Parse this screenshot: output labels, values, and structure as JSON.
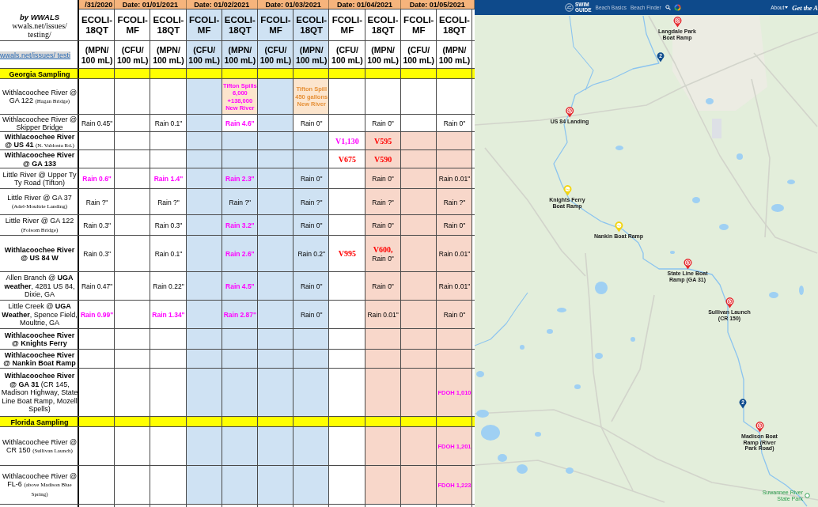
{
  "sheet": {
    "credit": "by WWALS",
    "site_url": "wwals.net/issues/ testing/",
    "link": "wwals.net/issues/ testi",
    "dates": [
      {
        "label": "/31/2020",
        "kind": "single"
      },
      {
        "label": "Date: 01/01/2021",
        "kind": "pair"
      },
      {
        "label": "Date: 01/02/2021",
        "kind": "pair"
      },
      {
        "label": "Date: 01/03/2021",
        "kind": "pair"
      },
      {
        "label": "Date: 01/04/2021",
        "kind": "pair"
      },
      {
        "label": "Date: 01/05/2021",
        "kind": "pair"
      }
    ],
    "columns": [
      {
        "test": "ECOLI-18QT",
        "unit": "(MPN/ 100 mL)",
        "highlighted": false
      },
      {
        "test": "FCOLI-MF",
        "unit": "(CFU/ 100 mL)",
        "highlighted": false
      },
      {
        "test": "ECOLI-18QT",
        "unit": "(MPN/ 100 mL)",
        "highlighted": false
      },
      {
        "test": "FCOLI-MF",
        "unit": "(CFU/ 100 mL)",
        "highlighted": true
      },
      {
        "test": "ECOLI-18QT",
        "unit": "(MPN/ 100 mL)",
        "highlighted": true
      },
      {
        "test": "FCOLI-MF",
        "unit": "(CFU/ 100 mL)",
        "highlighted": true
      },
      {
        "test": "ECOLI-18QT",
        "unit": "(MPN/ 100 mL)",
        "highlighted": true
      },
      {
        "test": "FCOLI-MF",
        "unit": "(CFU/ 100 mL)",
        "highlighted": false
      },
      {
        "test": "ECOLI-18QT",
        "unit": "(MPN/ 100 mL)",
        "highlighted": false
      },
      {
        "test": "FCOLI-MF",
        "unit": "(CFU/ 100 mL)",
        "highlighted": false
      },
      {
        "test": "ECOLI-18QT",
        "unit": "(MPN/ 100 mL)",
        "highlighted": false
      }
    ],
    "sections": [
      {
        "title": "Georgia Sampling",
        "rows": [
          {
            "site": "Withlacoochee River @ GA 122",
            "note": "(Hagan Bridge)",
            "bold": false,
            "cells": [
              null,
              null,
              null,
              null,
              {
                "text": "Tifton Spills 6,000 +138,000 New River",
                "kind": "spill",
                "color": "#ff00ff",
                "bold": true,
                "tinted": true
              },
              null,
              {
                "text": "Tifton Spill 450 gallons New River",
                "kind": "spill",
                "color": "#e69138",
                "bold": true,
                "tinted": true
              },
              null,
              null,
              null,
              null
            ]
          },
          {
            "site": "Withlacoochee River @ Skipper Bridge",
            "bold": false,
            "cells": [
              {
                "text": "Rain 0.45\"",
                "kind": "rain",
                "bold": false,
                "tinted": false
              },
              null,
              {
                "text": "Rain 0.1\"",
                "kind": "rain",
                "bold": false,
                "tinted": false
              },
              null,
              {
                "text": "Rain 4.6\"",
                "kind": "rain",
                "color": "#ff00ff",
                "bold": true,
                "tinted": false,
                "highlighted": false
              },
              null,
              {
                "text": "Rain 0\"",
                "kind": "rain",
                "bold": false,
                "tinted": false,
                "highlighted": false
              },
              null,
              {
                "text": "Rain 0\"",
                "kind": "rain",
                "bold": false,
                "tinted": false
              },
              null,
              {
                "text": "Rain 0\"",
                "kind": "rain",
                "bold": false,
                "tinted": false
              }
            ]
          },
          {
            "site": "Withlacoochee River @ US 41",
            "note": "(N. Valdosta Rd.)",
            "bold": true,
            "cells": [
              null,
              null,
              null,
              null,
              null,
              null,
              null,
              {
                "text": "V1,130",
                "kind": "count",
                "color": "#ff00ff",
                "bold": true,
                "tinted": false
              },
              {
                "text": "V595",
                "kind": "count",
                "color": "#ff0000",
                "bold": true,
                "tinted": true
              },
              {
                "tinted": true
              },
              {
                "tinted": true
              }
            ]
          },
          {
            "site": "Withlacoochee River @ GA 133",
            "bold": true,
            "cells": [
              null,
              null,
              null,
              null,
              null,
              null,
              null,
              {
                "text": "V675",
                "kind": "count",
                "color": "#ff0000",
                "bold": true,
                "tinted": false
              },
              {
                "text": "V590",
                "kind": "count",
                "color": "#ff0000",
                "bold": true,
                "tinted": true
              },
              {
                "tinted": true
              },
              {
                "tinted": true
              }
            ]
          },
          {
            "site": "Little River @ Upper Ty Ty Road (Tifton)",
            "bold": false,
            "cells": [
              {
                "text": "Rain 0.6\"",
                "kind": "rain",
                "color": "#ff00ff",
                "bold": true,
                "tinted": false
              },
              null,
              {
                "text": "Rain 1.4\"",
                "kind": "rain",
                "color": "#ff00ff",
                "bold": true,
                "tinted": false
              },
              null,
              {
                "text": "Rain 2.3\"",
                "kind": "rain",
                "color": "#ff00ff",
                "bold": true,
                "tinted": false
              },
              null,
              {
                "text": "Rain 0\"",
                "kind": "rain",
                "bold": false,
                "tinted": false
              },
              null,
              {
                "text": "Rain 0\"",
                "kind": "rain",
                "bold": false,
                "tinted": true
              },
              {
                "tinted": true
              },
              {
                "text": "Rain 0.01\"",
                "kind": "rain",
                "bold": false,
                "tinted": true
              }
            ]
          },
          {
            "site": "Little River @ GA 37",
            "note": "(Adel-Moultrie Landing)",
            "bold": false,
            "cells": [
              {
                "text": "Rain ?\"",
                "kind": "rain",
                "bold": false,
                "tinted": false
              },
              null,
              {
                "text": "Rain ?\"",
                "kind": "rain",
                "bold": false,
                "tinted": false
              },
              null,
              {
                "text": "Rain ?\"",
                "kind": "rain",
                "bold": false,
                "tinted": false
              },
              null,
              {
                "text": "Rain ?\"",
                "kind": "rain",
                "bold": false,
                "tinted": false
              },
              null,
              {
                "text": "Rain ?\"",
                "kind": "rain",
                "bold": false,
                "tinted": true
              },
              {
                "tinted": true
              },
              {
                "text": "Rain ?\"",
                "kind": "rain",
                "bold": false,
                "tinted": true
              }
            ]
          },
          {
            "site": "Little River @ GA 122",
            "note": "(Folsom Bridge)",
            "bold": false,
            "cells": [
              {
                "text": "Rain 0.3\"",
                "kind": "rain",
                "bold": false,
                "tinted": false
              },
              null,
              {
                "text": "Rain 0.3\"",
                "kind": "rain",
                "bold": false,
                "tinted": false
              },
              null,
              {
                "text": "Rain 3.2\"",
                "kind": "rain",
                "color": "#ff00ff",
                "bold": true,
                "tinted": false
              },
              null,
              {
                "text": "Rain 0\"",
                "kind": "rain",
                "bold": false,
                "tinted": false
              },
              null,
              {
                "text": "Rain 0\"",
                "kind": "rain",
                "bold": false,
                "tinted": true
              },
              {
                "tinted": true
              },
              {
                "text": "Rain 0\"",
                "kind": "rain",
                "bold": false,
                "tinted": true
              }
            ]
          },
          {
            "site": "Withlacoochee River @ US 84 W",
            "bold": true,
            "cells": [
              {
                "text": "Rain 0.3\"",
                "kind": "rain",
                "bold": false,
                "tinted": false
              },
              null,
              {
                "text": "Rain 0.1\"",
                "kind": "rain",
                "bold": false,
                "tinted": false
              },
              null,
              {
                "text": "Rain 2.6\"",
                "kind": "rain",
                "color": "#ff00ff",
                "bold": true,
                "tinted": false
              },
              null,
              {
                "text": "Rain 0.2\"",
                "kind": "rain",
                "bold": false,
                "tinted": false
              },
              {
                "text": "V995",
                "kind": "count",
                "color": "#ff0000",
                "bold": true,
                "tinted": false
              },
              {
                "text": "V600,",
                "kind": "count",
                "color": "#ff0000",
                "bold": true,
                "tinted": true,
                "after": "Rain 0\""
              },
              {
                "tinted": true
              },
              {
                "text": "Rain 0.01\"",
                "kind": "rain",
                "bold": false,
                "tinted": true
              }
            ]
          },
          {
            "site": "Allen  Branch @ **UGA weather**, 4281 US 84, Dixie, GA",
            "bold": false,
            "cells": [
              {
                "text": "Rain 0.47\"",
                "kind": "rain",
                "bold": false,
                "tinted": false
              },
              null,
              {
                "text": "Rain 0.22\"",
                "kind": "rain",
                "bold": false,
                "tinted": false
              },
              null,
              {
                "text": "Rain 4.5\"",
                "kind": "rain",
                "color": "#ff00ff",
                "bold": true,
                "tinted": false
              },
              null,
              {
                "text": "Rain 0\"",
                "kind": "rain",
                "bold": false,
                "tinted": false
              },
              null,
              {
                "text": "Rain 0\"",
                "kind": "rain",
                "bold": false,
                "tinted": true
              },
              {
                "tinted": true
              },
              {
                "text": "Rain 0.01\"",
                "kind": "rain",
                "bold": false,
                "tinted": true
              }
            ]
          },
          {
            "site": "Little Creek @ **UGA Weather**, Spence Field, Moultrie, GA",
            "bold": false,
            "cells": [
              {
                "text": "Rain 0.99\"",
                "kind": "rain",
                "color": "#ff00ff",
                "bold": true,
                "tinted": false
              },
              null,
              {
                "text": "Rain 1.34\"",
                "kind": "rain",
                "color": "#ff00ff",
                "bold": true,
                "tinted": false
              },
              null,
              {
                "text": "Rain 2.87\"",
                "kind": "rain",
                "color": "#ff00ff",
                "bold": true,
                "tinted": false
              },
              null,
              {
                "text": "Rain 0\"",
                "kind": "rain",
                "bold": false,
                "tinted": false
              },
              null,
              {
                "text": "Rain 0.01\"",
                "kind": "rain",
                "bold": false,
                "tinted": true
              },
              {
                "tinted": true
              },
              {
                "text": "Rain 0\"",
                "kind": "rain",
                "bold": false,
                "tinted": true
              }
            ]
          },
          {
            "site": "Withlacoochee River @ Knights Ferry",
            "bold": true,
            "cells": [
              null,
              null,
              null,
              null,
              null,
              null,
              null,
              null,
              {
                "tinted": true
              },
              {
                "tinted": true
              },
              {
                "tinted": true
              }
            ]
          },
          {
            "site": "Withlacoochee River @ Nankin Boat Ramp",
            "bold": true,
            "cells": [
              null,
              null,
              null,
              null,
              null,
              null,
              null,
              null,
              {
                "tinted": true
              },
              {
                "tinted": true
              },
              {
                "tinted": true
              }
            ]
          },
          {
            "site": "**Withlacoochee River @ GA 31** (CR 145, Madison Highway, State Line Boat Ramp, Mozell Spells)",
            "bold": false,
            "cells": [
              null,
              null,
              null,
              null,
              null,
              null,
              null,
              null,
              {
                "tinted": true
              },
              {
                "tinted": true
              },
              {
                "text": "FDOH 1,010",
                "kind": "fdoh",
                "color": "#ff00ff",
                "bold": true,
                "tinted": true
              }
            ]
          }
        ]
      },
      {
        "title": "Florida Sampling",
        "rows": [
          {
            "site": "Withlacoochee River @ CR 150",
            "note": "(Sullivan Launch)",
            "bold": false,
            "cells": [
              null,
              null,
              null,
              null,
              null,
              null,
              null,
              null,
              {
                "tinted": true
              },
              {
                "tinted": true
              },
              {
                "text": "FDOH 1,201",
                "kind": "fdoh",
                "color": "#ff00ff",
                "bold": true,
                "tinted": true
              }
            ]
          },
          {
            "site": "Withlacoochee River @ FL-6",
            "note": "(above Madison Blue Spring)",
            "bold": false,
            "cells": [
              null,
              null,
              null,
              null,
              null,
              null,
              null,
              null,
              {
                "tinted": true
              },
              {
                "tinted": true
              },
              {
                "text": "FDOH 1,223",
                "kind": "fdoh",
                "color": "#ff00ff",
                "bold": true,
                "tinted": true
              }
            ]
          }
        ]
      }
    ]
  },
  "swim_guide": {
    "brand": "SWIM GUIDE",
    "links": [
      {
        "label": "Beach Basics"
      },
      {
        "label": "Beach Finder"
      }
    ],
    "menu": "About",
    "app_link": "Get the A",
    "markers": [
      {
        "kind": "closed",
        "label": "Langdale Park Boat Ramp"
      },
      {
        "kind": "cluster",
        "count": "2"
      },
      {
        "kind": "closed",
        "label": "US 84 Landing"
      },
      {
        "kind": "caution",
        "label": "Knights Ferry Boat Ramp"
      },
      {
        "kind": "caution",
        "label": "Nankin Boat Ramp"
      },
      {
        "kind": "closed",
        "label": "State Line Boat Ramp (GA 31)"
      },
      {
        "kind": "closed",
        "label": "Sullivan Launch (CR 150)"
      },
      {
        "kind": "cluster",
        "count": "2"
      },
      {
        "kind": "closed",
        "label": "Madison Boat Ramp (River Park Road)"
      },
      {
        "kind": "park",
        "label": "Suwannee River State Park"
      }
    ]
  }
}
